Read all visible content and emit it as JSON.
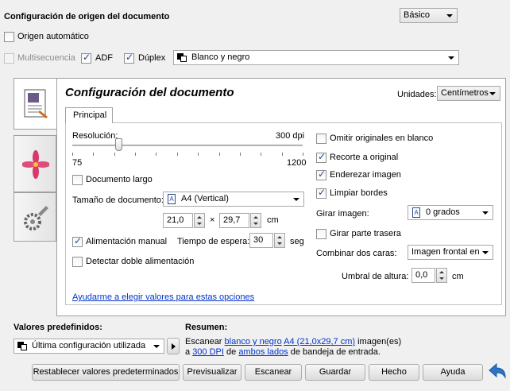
{
  "source": {
    "title": "Configuración de origen del documento",
    "mode": "Básico",
    "auto_source": "Origen automático",
    "multifeed": "Multisecuencia",
    "adf": "ADF",
    "duplex": "Dúplex",
    "color_mode": "Blanco y negro"
  },
  "doc": {
    "title": "Configuración del documento",
    "units_label": "Unidades:",
    "units_value": "Centímetros",
    "tab": "Principal",
    "resolution_label": "Resolución:",
    "resolution_value": "300 dpi",
    "resolution_min": "75",
    "resolution_max": "1200",
    "resolution_level": 0.2,
    "long_doc": "Documento largo",
    "size_label": "Tamaño de documento:",
    "size_value": "A4 (Vertical)",
    "width": "21,0",
    "times": "×",
    "height": "29,7",
    "size_unit": "cm",
    "manual_feed": "Alimentación manual",
    "wait_label": "Tiempo de espera:",
    "wait_value": "30",
    "wait_unit": "seg",
    "double_feed": "Detectar doble alimentación",
    "skip_blank": "Omitir originales en blanco",
    "crop": "Recorte a original",
    "deskew": "Enderezar imagen",
    "clean_edges": "Limpiar bordes",
    "rotate_label": "Girar imagen:",
    "rotate_value": "0 grados",
    "rotate_back": "Girar parte trasera",
    "combine_label": "Combinar dos caras:",
    "combine_value": "Imagen frontal en",
    "threshold_label": "Umbral de altura:",
    "threshold_value": "0,0",
    "threshold_unit": "cm",
    "help_link": "Ayudarme a elegir valores para estas opciones"
  },
  "presets": {
    "label": "Valores predefinidos:",
    "value": "Última configuración utilizada"
  },
  "summary": {
    "label": "Resumen:",
    "line1_prefix": "Escanear",
    "line1_link1": "blanco y negro",
    "line1_link2": "A4 (21,0x29,7 cm)",
    "line1_suffix": "imagen(es)",
    "line2_prefix": "a",
    "line2_link1": "300 DPI",
    "line2_mid": "de",
    "line2_link2": "ambos lados",
    "line2_suffix": "de bandeja de entrada."
  },
  "buttons": {
    "reset": "Restablecer valores predeterminados",
    "preview": "Previsualizar",
    "scan": "Escanear",
    "save": "Guardar",
    "done": "Hecho",
    "help": "Ayuda"
  },
  "colors": {
    "link": "#0033cc",
    "back_arrow": "#2a73c9"
  }
}
